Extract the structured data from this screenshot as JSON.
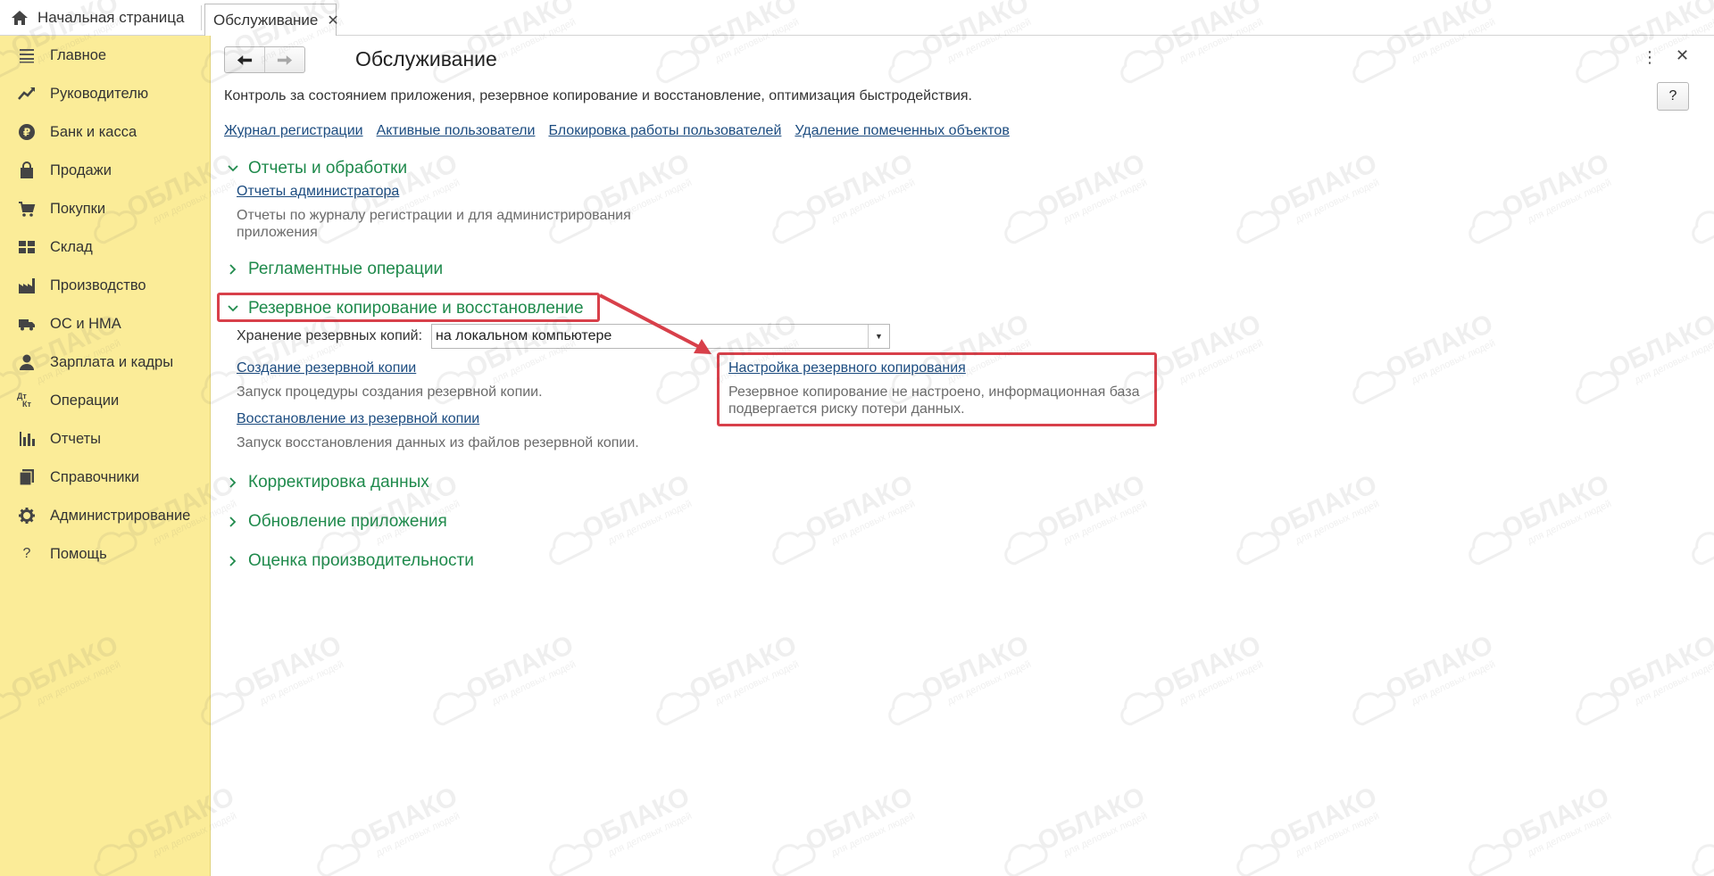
{
  "tabs": {
    "home_label": "Начальная страница",
    "active_label": "Обслуживание",
    "close_glyph": "✕"
  },
  "sidebar": {
    "items": [
      {
        "label": "Главное",
        "icon": "menu-lines-icon"
      },
      {
        "label": "Руководителю",
        "icon": "trend-chart-icon"
      },
      {
        "label": "Банк и касса",
        "icon": "ruble-coin-icon"
      },
      {
        "label": "Продажи",
        "icon": "shopping-bag-icon"
      },
      {
        "label": "Покупки",
        "icon": "cart-icon"
      },
      {
        "label": "Склад",
        "icon": "warehouse-grid-icon"
      },
      {
        "label": "Производство",
        "icon": "factory-icon"
      },
      {
        "label": "ОС и НМА",
        "icon": "truck-icon"
      },
      {
        "label": "Зарплата и кадры",
        "icon": "person-icon"
      },
      {
        "label": "Операции",
        "icon": "debit-credit-icon"
      },
      {
        "label": "Отчеты",
        "icon": "bar-chart-icon"
      },
      {
        "label": "Справочники",
        "icon": "book-icon"
      },
      {
        "label": "Администрирование",
        "icon": "gear-icon"
      },
      {
        "label": "Помощь",
        "icon": "question-icon"
      }
    ],
    "dt_kt_top": "Дт",
    "dt_kt_bottom": "Кт",
    "question_glyph": "?"
  },
  "main": {
    "title": "Обслуживание",
    "description": "Контроль за состоянием приложения, резервное копирование и восстановление, оптимизация быстродействия.",
    "help_label": "?",
    "more_glyph": "⋮",
    "close_glyph": "✕",
    "back_glyph": "🡐",
    "forward_glyph": "🡒",
    "top_links": [
      "Журнал регистрации",
      "Активные пользователи",
      "Блокировка работы пользователей",
      "Удаление помеченных объектов"
    ],
    "sections": {
      "reports": {
        "title": "Отчеты и обработки",
        "link": "Отчеты администратора",
        "desc_line1": "Отчеты по журналу регистрации и для администрирования",
        "desc_line2": "приложения"
      },
      "scheduled": {
        "title": "Регламентные операции"
      },
      "backup": {
        "title": "Резервное копирование и восстановление",
        "storage_label": "Хранение резервных копий:",
        "storage_value": "на локальном компьютере",
        "create_link": "Создание резервной копии",
        "create_desc": "Запуск процедуры создания резервной копии.",
        "restore_link": "Восстановление из резервной копии",
        "restore_desc": "Запуск восстановления данных из файлов резервной копии.",
        "settings_link": "Настройка резервного копирования",
        "settings_desc_line1": "Резервное копирование не настроено, информационная база",
        "settings_desc_line2": "подвергается риску потери данных."
      },
      "correction": {
        "title": "Корректировка данных"
      },
      "update": {
        "title": "Обновление приложения"
      },
      "performance": {
        "title": "Оценка производительности"
      }
    }
  },
  "watermark": {
    "text": "ОБЛАКО",
    "subtext": "для деловых людей"
  },
  "colors": {
    "sidebar_bg": "#fbec98",
    "section_green": "#1f8a4c",
    "link_blue": "#1c4c80",
    "highlight_red": "#d8404a"
  }
}
